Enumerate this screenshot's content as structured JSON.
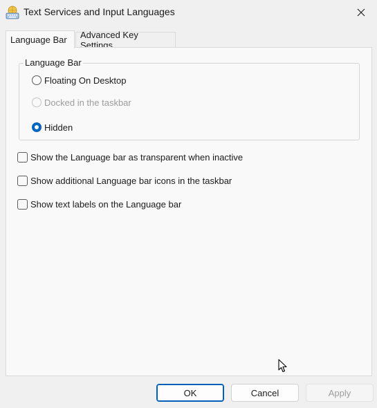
{
  "window": {
    "title": "Text Services and Input Languages",
    "app_icon": "keyboard-globe-icon",
    "close_icon": "close-icon"
  },
  "tabs": [
    {
      "label": "Language Bar",
      "selected": true
    },
    {
      "label": "Advanced Key Settings",
      "selected": false
    }
  ],
  "language_bar_group": {
    "legend": "Language Bar",
    "options": [
      {
        "label": "Floating On Desktop",
        "checked": false,
        "enabled": true
      },
      {
        "label": "Docked in the taskbar",
        "checked": false,
        "enabled": false
      },
      {
        "label": "Hidden",
        "checked": true,
        "enabled": true
      }
    ]
  },
  "checkboxes": [
    {
      "label": "Show the Language bar as transparent when inactive",
      "checked": false
    },
    {
      "label": "Show additional Language bar icons in the taskbar",
      "checked": false
    },
    {
      "label": "Show text labels on the Language bar",
      "checked": false
    }
  ],
  "buttons": {
    "ok": "OK",
    "cancel": "Cancel",
    "apply": "Apply"
  },
  "colors": {
    "accent": "#0067c0",
    "background": "#f0f0f0",
    "panel": "#f9f9f9"
  }
}
